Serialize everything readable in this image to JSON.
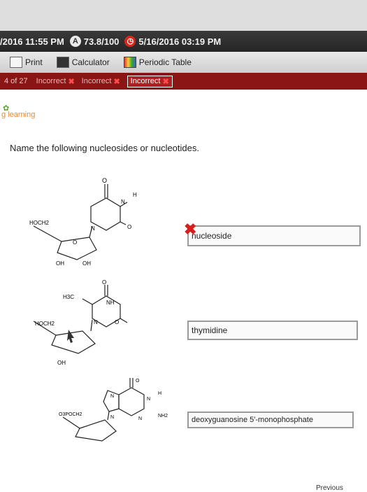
{
  "status": {
    "start_time": "/2016 11:55 PM",
    "score": "73.8/100",
    "due": "5/16/2016 03:19 PM"
  },
  "toolbar": {
    "print": "Print",
    "calculator": "Calculator",
    "periodic_table": "Periodic Table"
  },
  "tabs": {
    "position": "4 of 27",
    "items": [
      "Incorrect",
      "Incorrect",
      "Incorrect"
    ]
  },
  "brand": "g learning",
  "question": "Name the following nucleosides or nucleotides.",
  "structures": {
    "s1": {
      "hoch2": "HOCH2",
      "o_ring": "O",
      "o_top": "O",
      "o_right": "O",
      "n1": "N",
      "n2": "N",
      "h": "H",
      "oh1": "OH",
      "oh2": "OH"
    },
    "s2": {
      "hoch2": "HOCH2",
      "h3c": "H3C",
      "o_top": "O",
      "o_right": "O",
      "nh": "NH",
      "n": "N",
      "oh": "OH"
    },
    "s3": {
      "o3poch2": "O3POCH2",
      "o_top": "O",
      "n1": "N",
      "n2": "N",
      "n3": "N",
      "n4": "N",
      "h": "H",
      "nh2": "NH2"
    }
  },
  "answers": [
    "nucleoside",
    "thymidine",
    "deoxyguanosine 5'-monophosphate"
  ],
  "nav": {
    "previous": "Previous"
  }
}
